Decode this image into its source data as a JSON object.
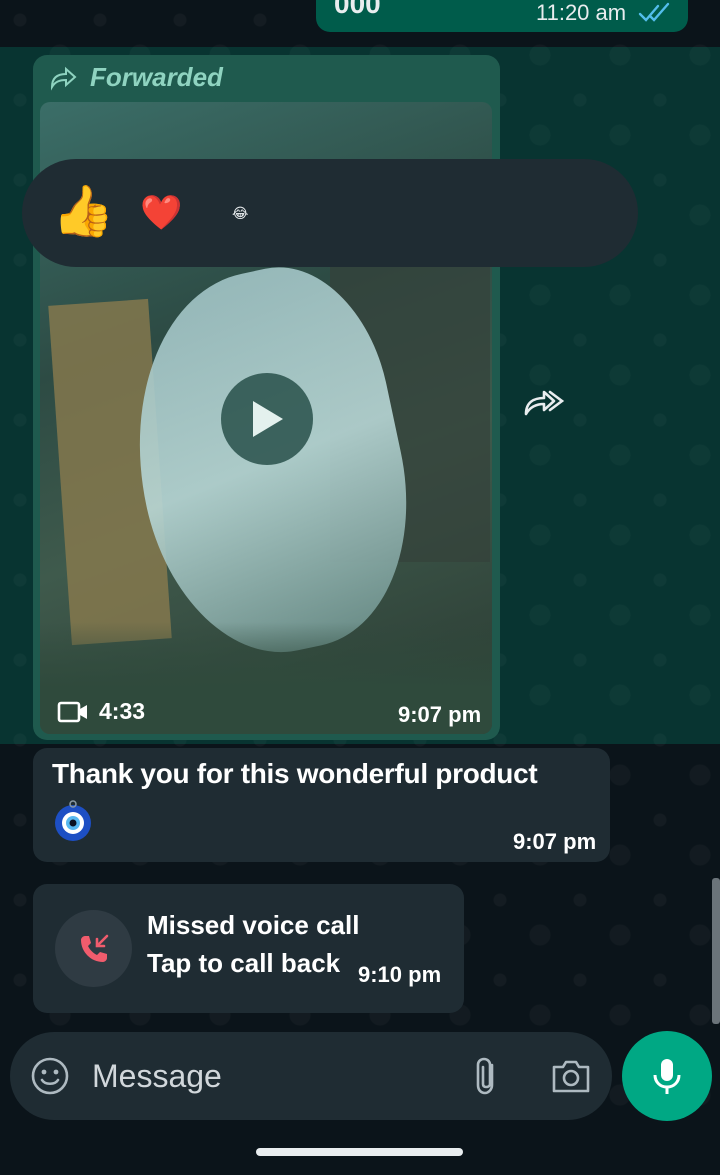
{
  "top_message": {
    "text_clip": "000",
    "time": "11:20 am",
    "tick_icon": "double-check-icon",
    "tick_color": "#53bdeb"
  },
  "forwarded_video": {
    "forwarded_label": "Forwarded",
    "duration": "4:33",
    "time": "9:07 pm",
    "play_icon": "play-icon"
  },
  "reactions": [
    "👍",
    "❤️",
    "😂"
  ],
  "text_message": {
    "text": "Thank you for this wonderful product",
    "emoji": "🧿",
    "time": "9:07 pm"
  },
  "missed_call": {
    "title": "Missed voice call",
    "subtitle": "Tap to call back",
    "time": "9:10 pm",
    "icon_color": "#f15c6d"
  },
  "composer": {
    "placeholder": "Message"
  },
  "colors": {
    "accent": "#00a884",
    "bubble_in": "#1f2c33",
    "bubble_out": "#005c4b"
  }
}
